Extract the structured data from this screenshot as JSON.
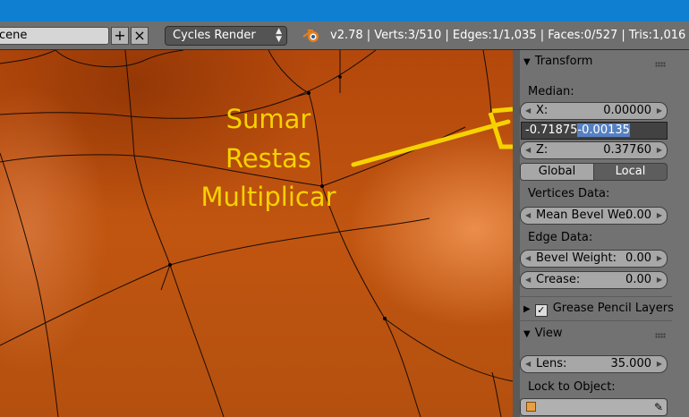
{
  "header": {
    "scene_name": "cene",
    "add_icon": "plus-icon",
    "remove_icon": "x-icon",
    "render_engine": "Cycles Render",
    "stats": "v2.78 | Verts:3/510 | Edges:1/1,035 | Faces:0/527 | Tris:1,016 | M"
  },
  "annotation": {
    "lines": [
      "Sumar",
      "Restas",
      "Multiplicar"
    ],
    "color": "#f6d200"
  },
  "panel": {
    "transform": {
      "title": "Transform",
      "median_label": "Median:",
      "x_label": "X:",
      "x_value": "0.00000",
      "edit_text_before": "-0.71875",
      "edit_text_selected": "-0.00135",
      "z_label": "Z:",
      "z_value": "0.37760",
      "global_label": "Global",
      "local_label": "Local"
    },
    "vertices_data": {
      "title": "Vertices Data:",
      "mean_bevel_label": "Mean Bevel We:",
      "mean_bevel_value": "0.00"
    },
    "edge_data": {
      "title": "Edge Data:",
      "bevel_weight_label": "Bevel Weight:",
      "bevel_weight_value": "0.00",
      "crease_label": "Crease:",
      "crease_value": "0.00"
    },
    "grease_pencil": {
      "title": "Grease Pencil Layers",
      "checked": true
    },
    "view": {
      "title": "View",
      "lens_label": "Lens:",
      "lens_value": "35.000",
      "lock_label": "Lock to Object:"
    }
  }
}
